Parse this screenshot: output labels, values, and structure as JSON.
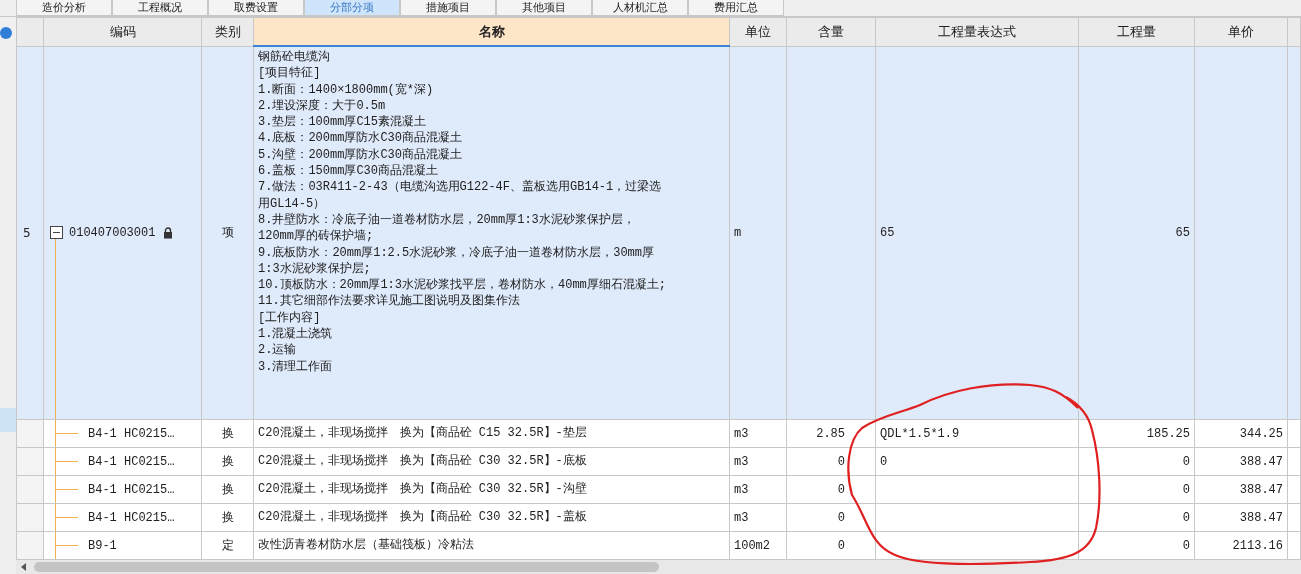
{
  "tabs": [
    {
      "label": "造价分析",
      "selected": false
    },
    {
      "label": "工程概况",
      "selected": false
    },
    {
      "label": "取费设置",
      "selected": false
    },
    {
      "label": "分部分项",
      "selected": true
    },
    {
      "label": "措施项目",
      "selected": false
    },
    {
      "label": "其他项目",
      "selected": false
    },
    {
      "label": "人材机汇总",
      "selected": false
    },
    {
      "label": "费用汇总",
      "selected": false
    }
  ],
  "table": {
    "columns": [
      {
        "label": "编码",
        "selected": false
      },
      {
        "label": "类别",
        "selected": false
      },
      {
        "label": "名称",
        "selected": true
      },
      {
        "label": "单位",
        "selected": false
      },
      {
        "label": "含量",
        "selected": false
      },
      {
        "label": "工程量表达式",
        "selected": false
      },
      {
        "label": "工程量",
        "selected": false
      },
      {
        "label": "单价",
        "selected": false
      }
    ],
    "rows": [
      {
        "number": "5",
        "expanded": true,
        "locked": true,
        "selected": true,
        "code": "010407003001",
        "type": "项",
        "name": "钢筋砼电缆沟\n[项目特征]\n1.断面：1400×1800mm(宽*深)\n2.埋设深度：大于0.5m\n3.垫层：100mm厚C15素混凝土\n4.底板：200mm厚防水C30商品混凝土\n5.沟壁：200mm厚防水C30商品混凝土\n6.盖板：150mm厚C30商品混凝土\n7.做法：03R411-2-43（电缆沟选用G122-4F、盖板选用GB14-1，过梁选用GL14-5）\n8.井壁防水：冷底子油一道卷材防水层，20mm厚1:3水泥砂浆保护层，120mm厚的砖保护墙;\n9.底板防水：20mm厚1:2.5水泥砂浆，冷底子油一道卷材防水层，30mm厚1:3水泥砂浆保护层;\n10.顶板防水：20mm厚1:3水泥砂浆找平层，卷材防水，40mm厚细石混凝土;\n11.其它细部作法要求详见施工图说明及图集作法\n[工作内容]\n1.混凝土浇筑\n2.运输\n3.清理工作面",
        "unit": "m",
        "expression": "65",
        "quantity": "65"
      },
      {
        "selected": false,
        "code": "B4-1 HC0215…",
        "type": "换",
        "name": "C20混凝土，非现场搅拌　换为【商品砼 C15 32.5R】-垫层",
        "unit": "m3",
        "content": "2.85",
        "expression": "QDL*1.5*1.9",
        "quantity": "185.25",
        "price": "344.25"
      },
      {
        "selected": false,
        "code": "B4-1 HC0215…",
        "type": "换",
        "name": "C20混凝土，非现场搅拌　换为【商品砼 C30 32.5R】-底板",
        "unit": "m3",
        "content": "0",
        "expression": "0",
        "quantity": "0",
        "price": "388.47"
      },
      {
        "selected": false,
        "code": "B4-1 HC0215…",
        "type": "换",
        "name": "C20混凝土，非现场搅拌　换为【商品砼 C30 32.5R】-沟壁",
        "unit": "m3",
        "content": "0",
        "quantity": "0",
        "price": "388.47"
      },
      {
        "selected": false,
        "code": "B4-1 HC0215…",
        "type": "换",
        "name": "C20混凝土，非现场搅拌　换为【商品砼 C30 32.5R】-盖板",
        "unit": "m3",
        "content": "0",
        "quantity": "0",
        "price": "388.47"
      },
      {
        "selected": false,
        "code": "B9-1",
        "type": "定",
        "name": "改性沥青卷材防水层（基础筏板）冷粘法",
        "unit": "100m2",
        "content": "0",
        "quantity": "0",
        "price": "2113.16"
      }
    ]
  }
}
